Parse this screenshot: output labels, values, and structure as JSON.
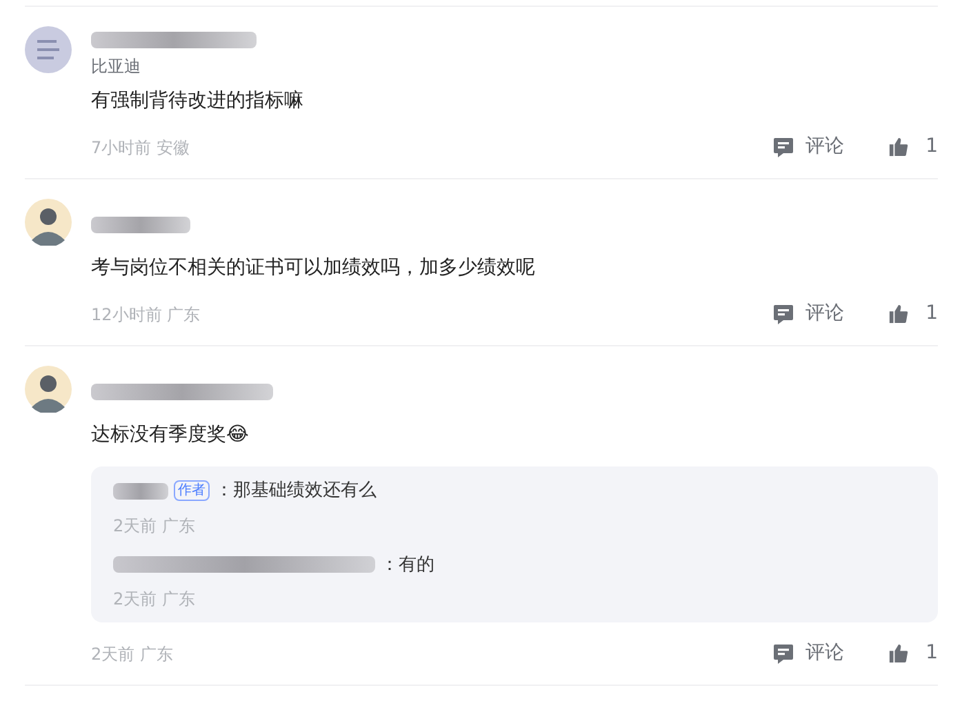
{
  "comments": [
    {
      "avatar": {
        "kind": "sketch"
      },
      "company": "比亚迪",
      "text": "有强制背待改进的指标嘛",
      "meta": "7小时前 安徽",
      "comment_label": "评论",
      "likes": "1"
    },
    {
      "avatar": {
        "kind": "person"
      },
      "text": "考与岗位不相关的证书可以加绩效吗，加多少绩效呢",
      "meta": "12小时前 广东",
      "comment_label": "评论",
      "likes": "1"
    },
    {
      "avatar": {
        "kind": "person"
      },
      "text": "达标没有季度奖😂",
      "meta": "2天前 广东",
      "comment_label": "评论",
      "likes": "1",
      "replies": [
        {
          "badge": "作者",
          "text": "：那基础绩效还有么",
          "meta": "2天前 广东"
        },
        {
          "text": "：有的",
          "meta": "2天前 广东"
        }
      ]
    }
  ]
}
